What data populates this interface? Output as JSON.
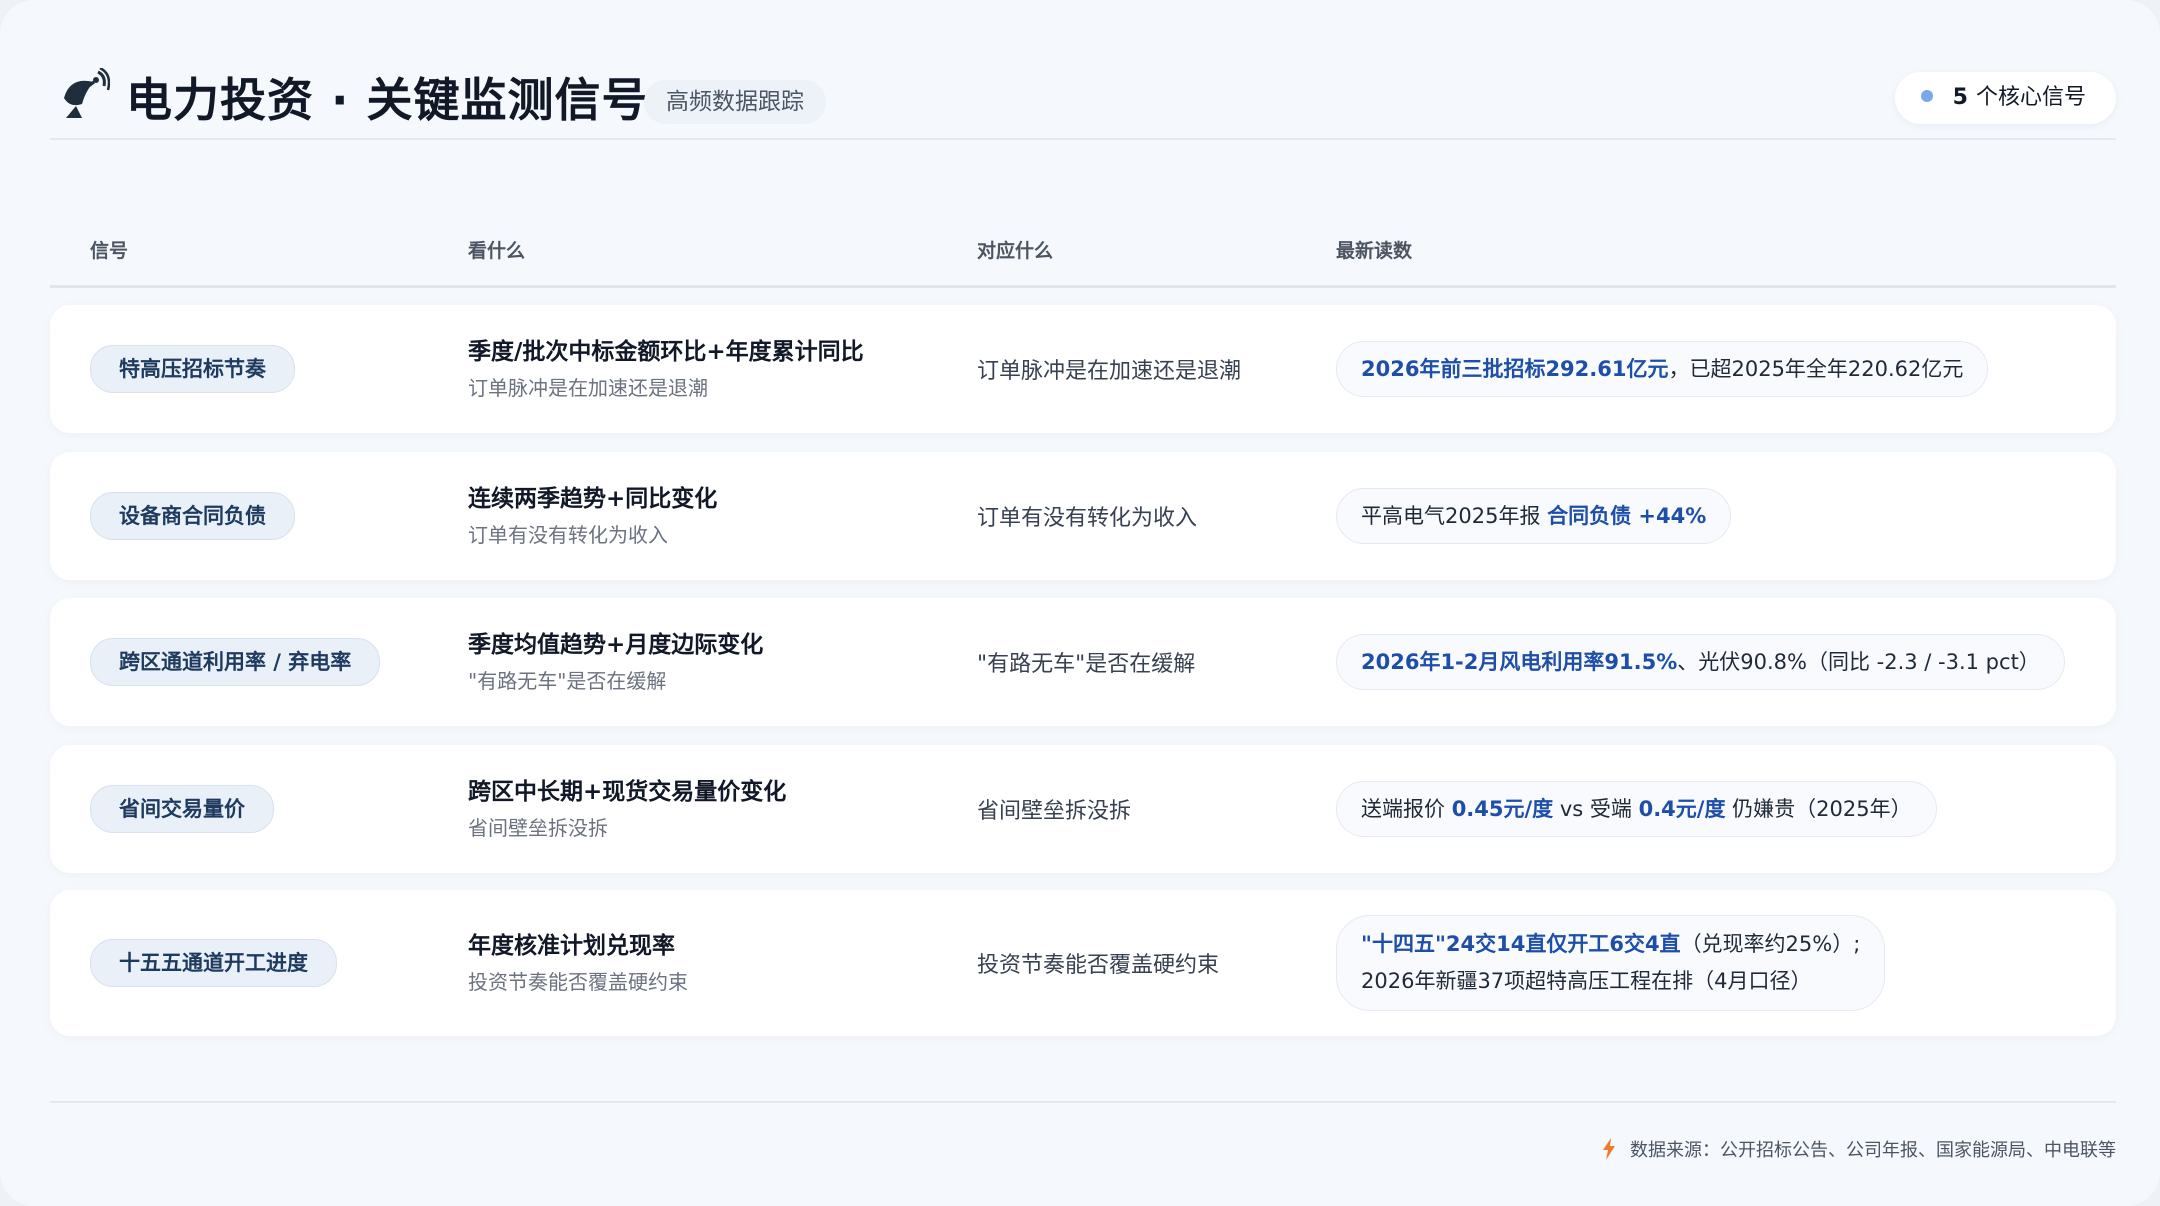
{
  "header": {
    "title": "电力投资 · 关键监测信号",
    "subtitle": "高频数据跟踪",
    "signal_count": "5",
    "signal_count_label": "个核心信号",
    "accent": "#1d4ea8"
  },
  "table": {
    "columns": [
      "信号",
      "看什么",
      "对应什么",
      "最新读数"
    ],
    "rows": [
      {
        "signal": "特高压招标节奏",
        "what_main": "季度/批次中标金额环比+年度累计同比",
        "what_sub": "订单脉冲是在加速还是退潮",
        "means": "订单脉冲是在加速还是退潮",
        "reading": [
          {
            "text": "2026年前三批招标292.61亿元",
            "hl": true
          },
          {
            "text": "，已超2025年全年220.62亿元",
            "hl": false
          }
        ]
      },
      {
        "signal": "设备商合同负债",
        "what_main": "连续两季趋势+同比变化",
        "what_sub": "订单有没有转化为收入",
        "means": "订单有没有转化为收入",
        "reading": [
          {
            "text": "平高电气2025年报 ",
            "hl": false
          },
          {
            "text": "合同负债 +44%",
            "hl": true
          }
        ]
      },
      {
        "signal": "跨区通道利用率 / 弃电率",
        "what_main": "季度均值趋势+月度边际变化",
        "what_sub": "\"有路无车\"是否在缓解",
        "means": "\"有路无车\"是否在缓解",
        "reading": [
          {
            "text": "2026年1-2月风电利用率91.5%",
            "hl": true
          },
          {
            "text": "、光伏90.8%（同比 -2.3 / -3.1 pct）",
            "hl": false
          }
        ]
      },
      {
        "signal": "省间交易量价",
        "what_main": "跨区中长期+现货交易量价变化",
        "what_sub": "省间壁垒拆没拆",
        "means": "省间壁垒拆没拆",
        "reading": [
          {
            "text": "送端报价 ",
            "hl": false
          },
          {
            "text": "0.45元/度",
            "hl": true
          },
          {
            "text": " vs 受端 ",
            "hl": false
          },
          {
            "text": "0.4元/度",
            "hl": true
          },
          {
            "text": " 仍嫌贵（2025年）",
            "hl": false
          }
        ]
      },
      {
        "signal": "十五五通道开工进度",
        "what_main": "年度核准计划兑现率",
        "what_sub": "投资节奏能否覆盖硬约束",
        "means": "投资节奏能否覆盖硬约束",
        "reading_line1": [
          {
            "text": "\"十四五\"24交14直仅开工6交4直",
            "hl": true
          },
          {
            "text": "（兑现率约25%）;",
            "hl": false
          }
        ],
        "reading_line2": "2026年新疆37项超特高压工程在排（4月口径）"
      }
    ]
  },
  "footer": {
    "source": "数据来源：公开招标公告、公司年报、国家能源局、中电联等"
  }
}
